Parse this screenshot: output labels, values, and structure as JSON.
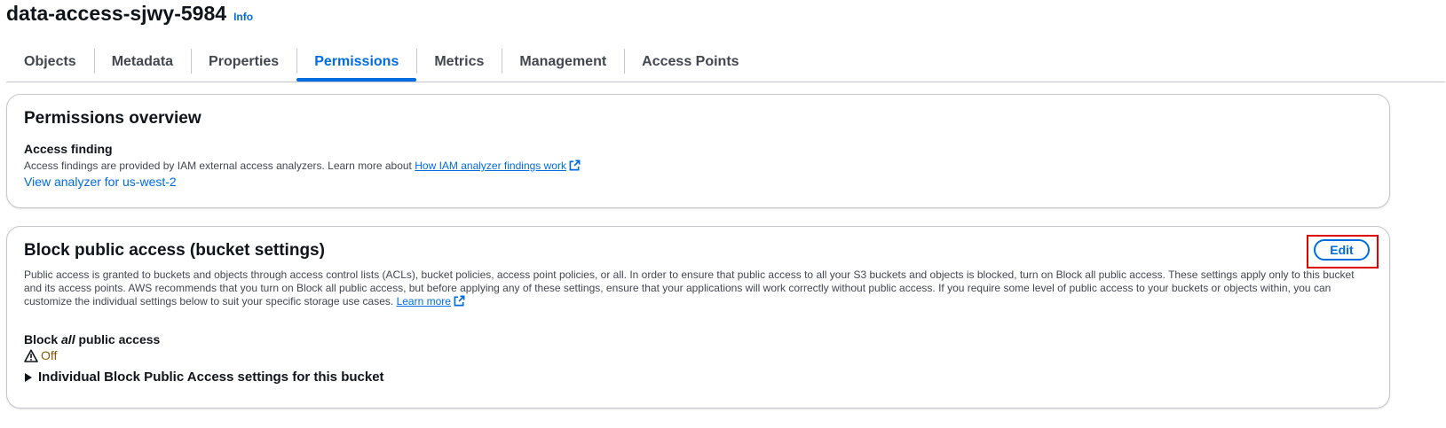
{
  "header": {
    "title": "data-access-sjwy-5984",
    "info": "Info"
  },
  "tabs": [
    {
      "label": "Objects"
    },
    {
      "label": "Metadata"
    },
    {
      "label": "Properties"
    },
    {
      "label": "Permissions",
      "active": true
    },
    {
      "label": "Metrics"
    },
    {
      "label": "Management"
    },
    {
      "label": "Access Points"
    }
  ],
  "permissions_overview": {
    "heading": "Permissions overview",
    "access_finding_label": "Access finding",
    "description": "Access findings are provided by IAM external access analyzers. Learn more about",
    "findings_link": "How IAM analyzer findings work",
    "analyzer_link": "View analyzer for us-west-2"
  },
  "block_public_access": {
    "heading": "Block public access (bucket settings)",
    "edit_label": "Edit",
    "description": "Public access is granted to buckets and objects through access control lists (ACLs), bucket policies, access point policies, or all. In order to ensure that public access to all your S3 buckets and objects is blocked, turn on Block all public access. These settings apply only to this bucket and its access points. AWS recommends that you turn on Block all public access, but before applying any of these settings, ensure that your applications will work correctly without public access. If you require some level of public access to your buckets or objects within, you can customize the individual settings below to suit your specific storage use cases.",
    "learn_more": "Learn more",
    "block_all_prefix": "Block",
    "block_all_em": "all",
    "block_all_suffix": "public access",
    "status": "Off",
    "expander_label": "Individual Block Public Access settings for this bucket"
  },
  "colors": {
    "accent": "#006ce0",
    "warning": "#855900",
    "highlight": "#e00000"
  }
}
